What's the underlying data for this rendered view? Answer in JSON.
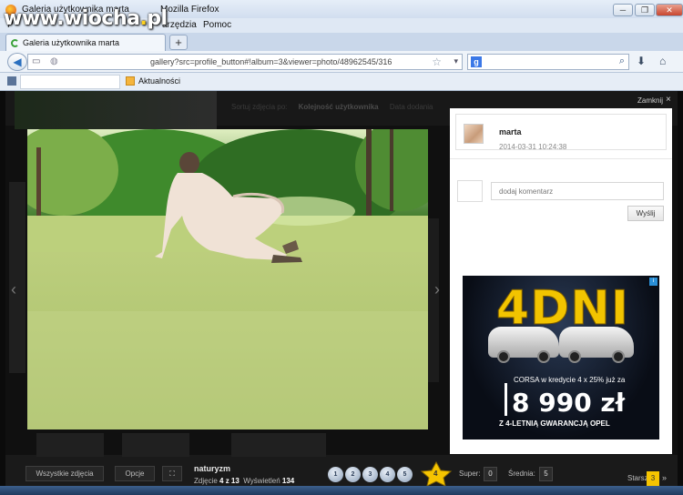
{
  "browser": {
    "window_title": "Galeria użytkownika marta",
    "window_title_suffix": "Mozilla Firefox",
    "watermark_logo": "www.wiocha.pl",
    "menu": [
      "P",
      "arzędzia",
      "Pomoc"
    ],
    "tab_title": "Galeria użytkownika marta",
    "new_tab_label": "+",
    "url": "gallery?src=profile_button#!album=3&viewer=photo/48962545/316",
    "window_buttons": {
      "minimize": "─",
      "maximize": "❐",
      "close": "✕"
    },
    "bookmarks": [
      {
        "label": "Aktualności"
      }
    ]
  },
  "page": {
    "sort_label": "Sortuj zdjęcia po:",
    "sort_option": "Kolejność użytkownika",
    "sort_alt": "Data dodania",
    "close_label": "Zamknij",
    "close_icon": "×"
  },
  "author": {
    "name": "marta",
    "date": "2014-03-31 10:24:38"
  },
  "comment": {
    "placeholder": "dodaj komentarz",
    "submit_label": "Wyślij"
  },
  "ad": {
    "headline": "4DNI",
    "subline": "CORSA w kredycie 4 x 25% już za",
    "price": "8 990 zł",
    "footer": "Z 4-LETNIĄ GWARANCJĄ OPEL",
    "info_icon": "i"
  },
  "bottom": {
    "all_photos_label": "Wszystkie zdjęcia",
    "options_label": "Opcje",
    "album_title": "naturyzm",
    "photo_label": "Zdjęcie",
    "photo_position": "4 z 13",
    "views_label": "Wyświetleń",
    "views_count": "134",
    "rating_buttons": [
      "1",
      "2",
      "3",
      "4",
      "5"
    ],
    "star_badge": "4",
    "super_label": "Super:",
    "super_count": "0",
    "avg_label": "Średnia:",
    "avg_value": "5",
    "older_label": "Starsze",
    "older_count": "3",
    "older_arrow": "»"
  },
  "colors": {
    "accent": "#f5c400",
    "page_bg": "#101010"
  }
}
